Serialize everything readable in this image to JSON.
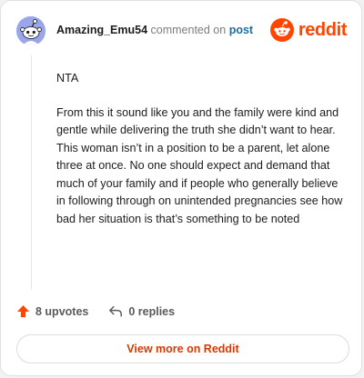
{
  "comment": {
    "username": "Amazing_Emu54",
    "action_text": "commented on",
    "post_link_text": "post",
    "avatar_color": "#9aa6ea",
    "body": [
      "NTA",
      "From this it sound like you and the family were kind and gentle while delivering the truth she didn’t want to hear. This woman isn’t in a position to be a parent, let alone three at once. No one should expect and demand that much of your family and if people who generally believe in following through on unintended pregnancies see how bad her situation is that’s something to be noted"
    ]
  },
  "brand": {
    "name": "reddit",
    "icon": "reddit-snoo-icon",
    "color": "#ff4500"
  },
  "footer": {
    "upvotes_label": "8 upvotes",
    "upvote_icon": "upvote-arrow-icon",
    "upvote_color": "#ff4500",
    "replies_label": "0 replies",
    "reply_icon": "reply-arrow-icon"
  },
  "cta": {
    "label": "View more on Reddit",
    "color": "#d93900"
  }
}
